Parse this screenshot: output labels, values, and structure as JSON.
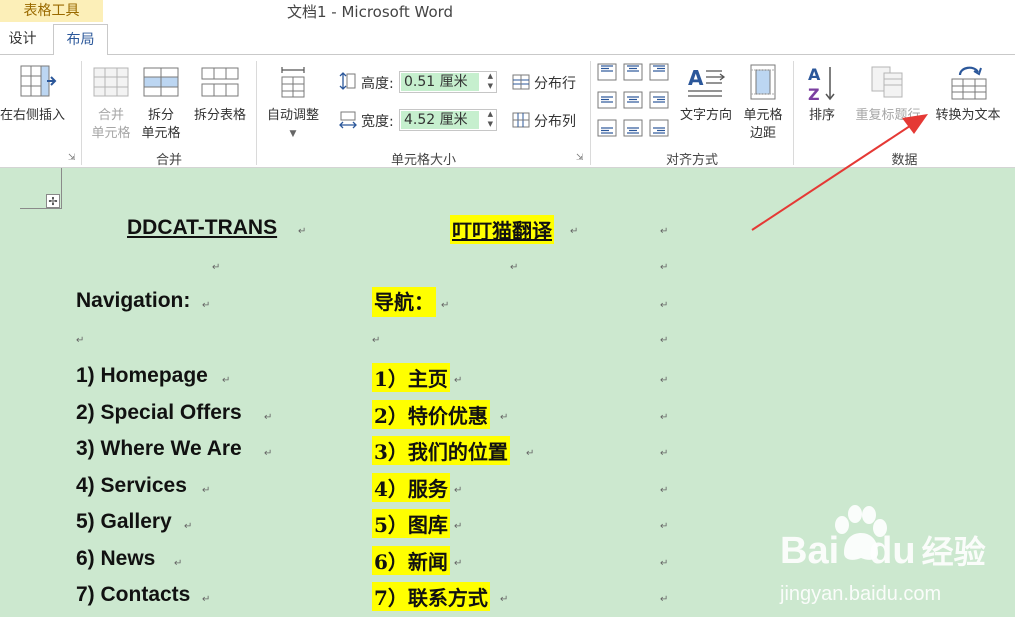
{
  "window": {
    "contextual_tab_group": "表格工具",
    "title": "文档1 - Microsoft Word"
  },
  "tabs": [
    {
      "label": "设计"
    },
    {
      "label": "布局",
      "active": true
    }
  ],
  "ribbon": {
    "rows_columns": {
      "insert_right_label": "在右侧插入",
      "launcher": "⇲"
    },
    "merge": {
      "merge_cells_line1": "合并",
      "merge_cells_line2": "单元格",
      "split_cells_line1": "拆分",
      "split_cells_line2": "单元格",
      "split_table_label": "拆分表格",
      "group_label": "合并"
    },
    "cell_size": {
      "autofit_label": "自动调整",
      "height_label": "高度:",
      "height_value": "0.51 厘米",
      "width_label": "宽度:",
      "width_value": "4.52 厘米",
      "distribute_rows_label": "分布行",
      "distribute_cols_label": "分布列",
      "group_label": "单元格大小",
      "launcher": "⇲"
    },
    "alignment": {
      "text_direction_label": "文字方向",
      "cell_margins_line1": "单元格",
      "cell_margins_line2": "边距",
      "group_label": "对齐方式"
    },
    "data": {
      "sort_label": "排序",
      "repeat_header_label": "重复标题行",
      "convert_to_text_label": "转换为文本",
      "group_label": "数据"
    }
  },
  "document": {
    "header_en": "DDCAT-TRANS",
    "header_zh": "叮叮猫翻译",
    "nav_en": "Navigation:",
    "nav_zh": "导航：",
    "items": [
      {
        "en": "1) Homepage",
        "zh": "1）主页"
      },
      {
        "en": "2) Special Offers",
        "zh": "2）特价优惠"
      },
      {
        "en": "3) Where We Are",
        "zh": "3）我们的位置"
      },
      {
        "en": "4) Services",
        "zh": "4）服务"
      },
      {
        "en": "5) Gallery",
        "zh": "5）图库"
      },
      {
        "en": "6) News",
        "zh": "6）新闻"
      },
      {
        "en": "7) Contacts",
        "zh": "7）联系方式"
      }
    ],
    "cell_mark": "↵",
    "move_handle": "✢"
  },
  "watermark": {
    "brand": "Bai",
    "brand_end": "du",
    "product": "经验",
    "url": "jingyan.baidu.com"
  },
  "colors": {
    "doc_background": "#cce8cf",
    "highlight": "#ffff00",
    "arrow": "#e53935",
    "tab_accent": "#2b579a"
  }
}
